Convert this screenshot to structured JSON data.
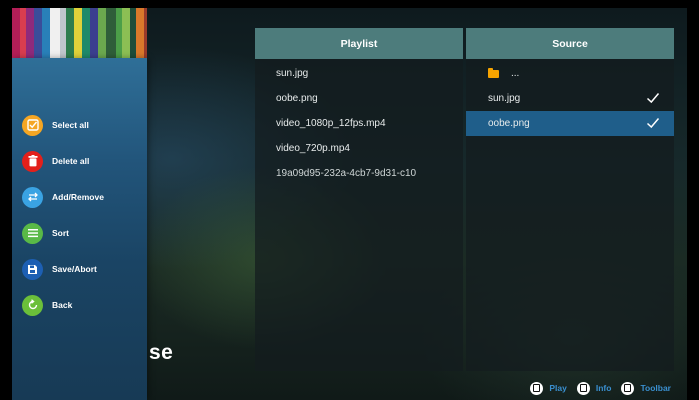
{
  "sidebar": {
    "items": [
      {
        "label": "Select all",
        "icon": "select-all-icon",
        "color": "#f5a623"
      },
      {
        "label": "Delete all",
        "icon": "trash-icon",
        "color": "#e3201b"
      },
      {
        "label": "Add/Remove",
        "icon": "swap-icon",
        "color": "#3aa3e3"
      },
      {
        "label": "Sort",
        "icon": "list-icon",
        "color": "#59b947"
      },
      {
        "label": "Save/Abort",
        "icon": "save-icon",
        "color": "#1d5fb3"
      },
      {
        "label": "Back",
        "icon": "back-icon",
        "color": "#6bbf3a"
      }
    ]
  },
  "background_text": "se",
  "playlist": {
    "header": "Playlist",
    "items": [
      "sun.jpg",
      "oobe.png",
      "video_1080p_12fps.mp4",
      "video_720p.mp4",
      "19a09d95-232a-4cb7-9d31-c10"
    ]
  },
  "source": {
    "header": "Source",
    "folder_label": "...",
    "items": [
      {
        "label": "sun.jpg",
        "checked": true,
        "selected": false
      },
      {
        "label": "oobe.png",
        "checked": true,
        "selected": true
      }
    ]
  },
  "footer": {
    "play_label": "Play",
    "info_label": "Info",
    "toolbar_label": "Toolbar"
  },
  "colors": {
    "header_teal": "#4d7c7c",
    "selected_row": "#1f5e8a",
    "footer_blue": "#3a8fcf"
  }
}
